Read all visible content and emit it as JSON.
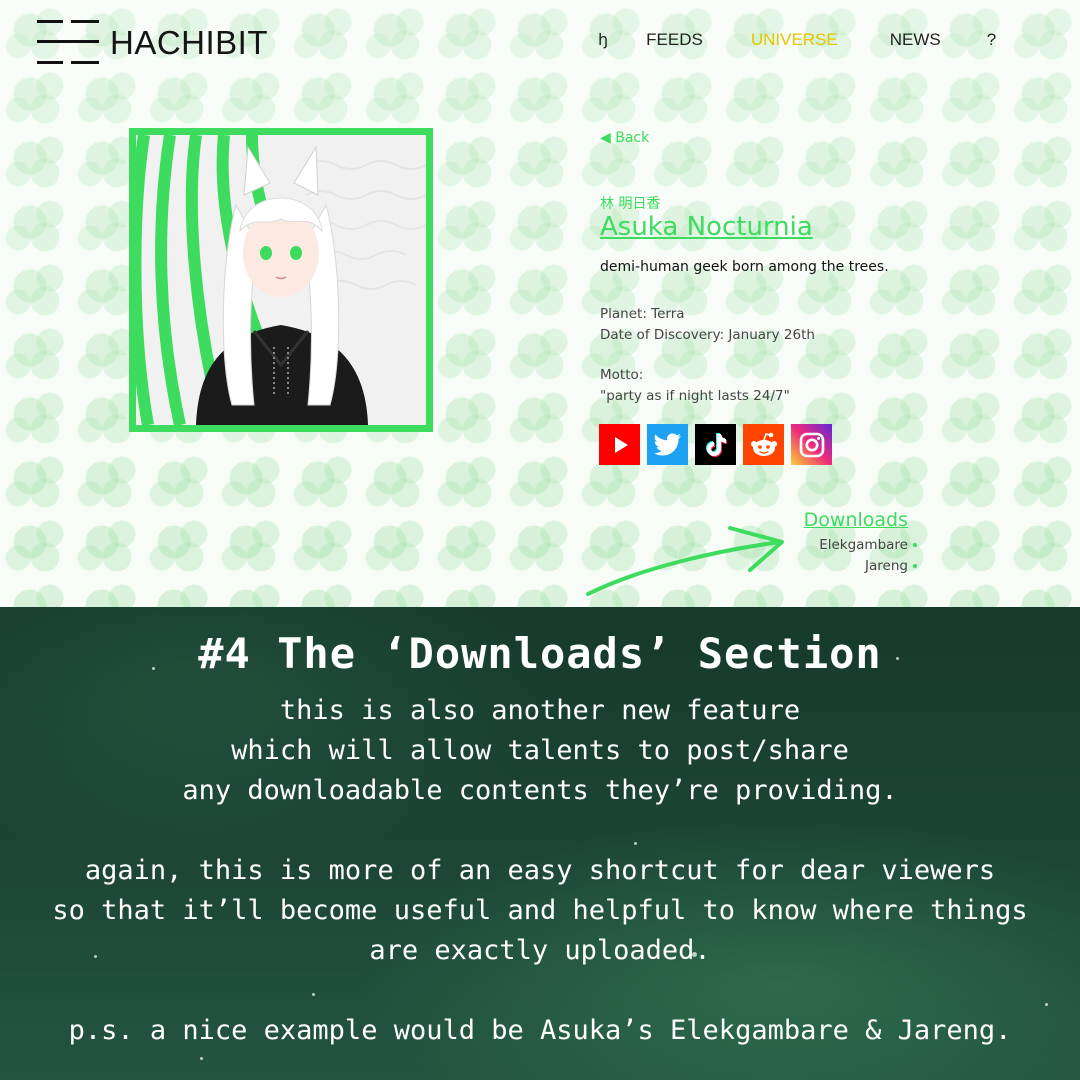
{
  "brand": {
    "name": "HACHIBIT",
    "logo_icon": "menu-lines-icon"
  },
  "nav": {
    "home_icon": "ꜧ",
    "items": [
      {
        "label": "FEEDS",
        "color": "#222222"
      },
      {
        "label": "UNIVERSE",
        "color": "#e6c400"
      },
      {
        "label": "NEWS",
        "color": "#222222"
      },
      {
        "label": "?",
        "color": "#222222"
      }
    ]
  },
  "profile": {
    "back_label": "◀ Back",
    "native_name": "林 明日香",
    "name": "Asuka Nocturnia",
    "tagline": "demi-human geek born among the trees.",
    "planet": "Planet: Terra",
    "discovery": "Date of Discovery: January 26th",
    "motto_label": "Motto:",
    "motto": "\"party as if night lasts 24/7\"",
    "accent_color": "#3ddb5e",
    "socials": [
      "youtube-icon",
      "twitter-icon",
      "tiktok-icon",
      "reddit-icon",
      "instagram-icon"
    ]
  },
  "downloads": {
    "title": "Downloads",
    "items": [
      "Elekgambare",
      "Jareng"
    ]
  },
  "caption": {
    "title": "#4 The ‘Downloads’ Section",
    "paragraph1": [
      "this is also another new feature",
      "which will allow talents to post/share",
      "any downloadable contents they’re providing."
    ],
    "paragraph2": [
      "again, this is more of an easy shortcut for dear viewers",
      "so that it’ll become useful and helpful to know where things",
      "are exactly uploaded."
    ],
    "paragraph3": [
      "p.s. a nice example would be Asuka’s Elekgambare & Jareng."
    ]
  }
}
